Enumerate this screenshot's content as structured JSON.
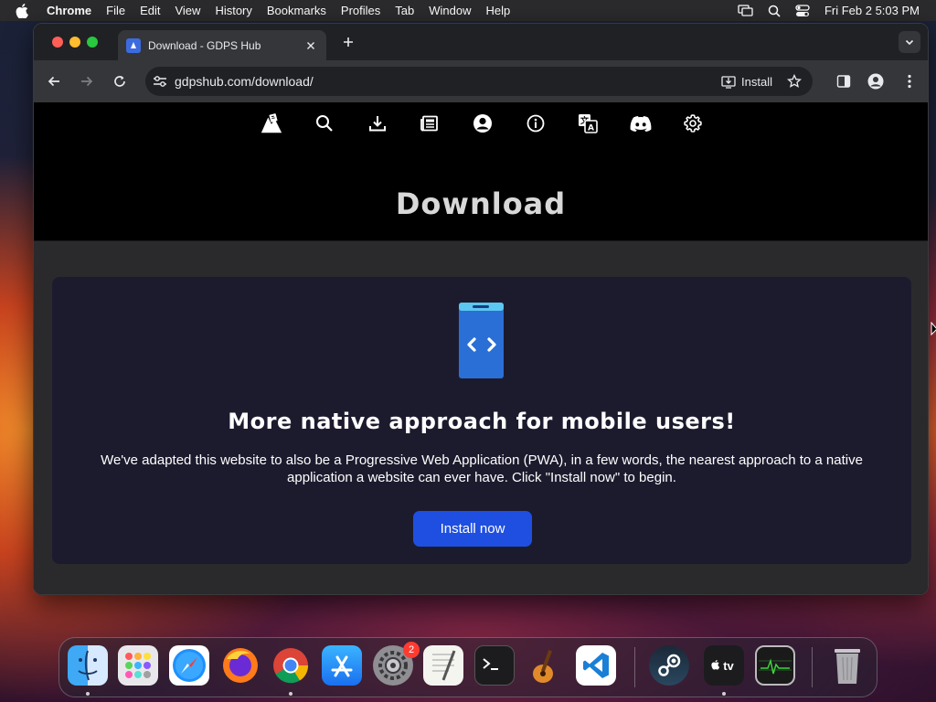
{
  "menubar": {
    "app_name": "Chrome",
    "items": [
      "File",
      "Edit",
      "View",
      "History",
      "Bookmarks",
      "Profiles",
      "Tab",
      "Window",
      "Help"
    ],
    "clock": "Fri Feb 2  5:03 PM",
    "right_icons": [
      "screen-mirroring-icon",
      "spotlight-search-icon",
      "control-center-icon"
    ]
  },
  "browser": {
    "tab_title": "Download - GDPS Hub",
    "url": "gdpshub.com/download/",
    "install_label": "Install"
  },
  "site": {
    "nav_icons": [
      "gdps-hub-logo-icon",
      "search-icon",
      "download-icon",
      "news-icon",
      "account-icon",
      "info-icon",
      "translate-icon",
      "discord-icon",
      "settings-icon"
    ],
    "page_title": "Download",
    "card": {
      "heading": "More native approach for mobile users!",
      "text": "We've adapted this website to also be a Progressive Web Application (PWA), in a few words, the nearest approach to a native application a website can ever have. Click \"Install now\" to begin.",
      "button_label": "Install now"
    }
  },
  "dock": {
    "apps": [
      "Finder",
      "Launchpad",
      "Safari",
      "Firefox",
      "Google Chrome",
      "App Store",
      "System Settings",
      "TextEdit",
      "Terminal",
      "GarageBand",
      "Visual Studio Code",
      "Steam",
      "Apple TV",
      "Activity Monitor",
      "Trash"
    ],
    "system_settings_badge": "2"
  },
  "colors": {
    "accent_button": "#1f4fe0",
    "card_background": "#1c1b2e",
    "phone_icon": "#2a6fd6"
  }
}
